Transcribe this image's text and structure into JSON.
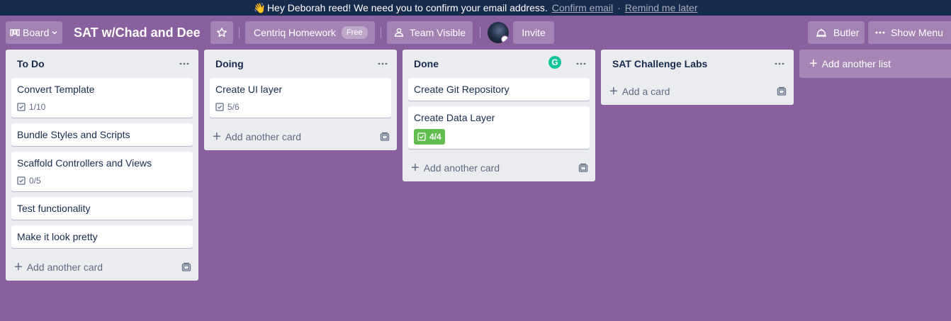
{
  "banner": {
    "emoji": "👋",
    "message": "Hey Deborah reed! We need you to confirm your email address.",
    "confirm_link": "Confirm email",
    "separator": "·",
    "remind_link": "Remind me later"
  },
  "header": {
    "board_switcher": "Board",
    "board_title": "SAT w/Chad and Dee",
    "team_name": "Centriq Homework",
    "team_plan": "Free",
    "visibility": "Team Visible",
    "invite": "Invite",
    "butler": "Butler",
    "show_menu": "Show Menu"
  },
  "lists": [
    {
      "title": "To Do",
      "cards": [
        {
          "title": "Convert Template",
          "checklist": "1/10"
        },
        {
          "title": "Bundle Styles and Scripts"
        },
        {
          "title": "Scaffold Controllers and Views",
          "checklist": "0/5"
        },
        {
          "title": "Test functionality"
        },
        {
          "title": "Make it look pretty"
        }
      ],
      "add_label": "Add another card"
    },
    {
      "title": "Doing",
      "cards": [
        {
          "title": "Create UI layer",
          "checklist": "5/6"
        }
      ],
      "add_label": "Add another card"
    },
    {
      "title": "Done",
      "cards": [
        {
          "title": "Create Git Repository"
        },
        {
          "title": "Create Data Layer",
          "checklist": "4/4",
          "complete": true
        }
      ],
      "add_label": "Add another card"
    },
    {
      "title": "SAT Challenge Labs",
      "cards": [],
      "add_label": "Add a card"
    }
  ],
  "add_list_label": "Add another list",
  "grammarly_letter": "G",
  "colors": {
    "board_bg": "#89609e",
    "banner_bg": "#172b4d",
    "list_bg": "#ebecf0",
    "complete_green": "#61bd4f"
  }
}
